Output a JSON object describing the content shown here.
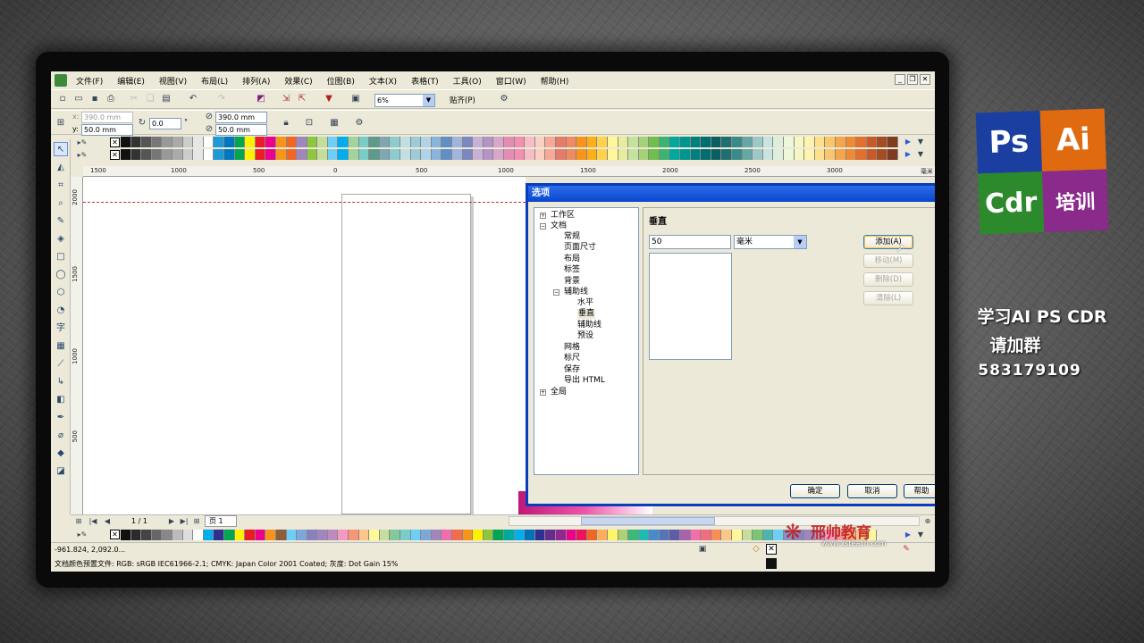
{
  "menu": [
    "文件(F)",
    "编辑(E)",
    "视图(V)",
    "布局(L)",
    "排列(A)",
    "效果(C)",
    "位图(B)",
    "文本(X)",
    "表格(T)",
    "工具(O)",
    "窗口(W)",
    "帮助(H)"
  ],
  "window_controls": [
    "_",
    "❐",
    "✕"
  ],
  "toolbar": {
    "zoom_value": "6%",
    "snap_label": "贴齐(P)"
  },
  "property_bar": {
    "x_value": "390.0 mm",
    "y_value": "50.0 mm",
    "x_prefix": "x:",
    "y_prefix": "y:",
    "angle_value": "0.0",
    "angle_unit": "°",
    "width_value": "390.0 mm",
    "height_value": "50.0 mm"
  },
  "ruler_h_labels": [
    "1500",
    "1000",
    "500",
    "0",
    "500",
    "1000",
    "1500",
    "2000",
    "2500",
    "3000"
  ],
  "ruler_h_unit": "毫米",
  "ruler_v_labels": [
    "2000",
    "1500",
    "1000",
    "500"
  ],
  "palette_top": [
    "#111111",
    "#333333",
    "#555555",
    "#777777",
    "#999999",
    "#aaaaaa",
    "#cccccc",
    "#e6e6e6",
    "#ffffff",
    "#1d9bd6",
    "#0077c0",
    "#00a650",
    "#fff200",
    "#ed1c24",
    "#ec008c",
    "#f7941d",
    "#f26522",
    "#a186be",
    "#8dc63f",
    "#c4df9b",
    "#6dcff6",
    "#00aeef",
    "#a3d39c",
    "#7accc8",
    "#5e9a8b",
    "#7ea7b1",
    "#8ccbd0",
    "#c2e0e3",
    "#9ecbd6",
    "#b1d3e8",
    "#89b4dc",
    "#5f8fc5",
    "#a1b4dc",
    "#7c86c1",
    "#c7b1d6",
    "#b394c5",
    "#d7a6c8",
    "#e58cb3",
    "#f48fb1",
    "#f7bdc7",
    "#fbd0c0",
    "#f7a996",
    "#e57b6a",
    "#ef8a62",
    "#f7941d",
    "#fcaf17",
    "#ffd24c",
    "#fff799",
    "#e6ee9c",
    "#c6e29f",
    "#a5d276",
    "#6ebf4b",
    "#3cb371",
    "#00a99d",
    "#00958f",
    "#007f7f",
    "#006d6f",
    "#0b5f61",
    "#1e6f70",
    "#3a8a8a",
    "#66a8a6",
    "#9cc9c7",
    "#c9e3e1",
    "#ddeedd",
    "#eef7d9",
    "#f7f7c6",
    "#fff3b0",
    "#ffe08a",
    "#f9c66b",
    "#f5a54b",
    "#ee8a36",
    "#e36f2c",
    "#c75a28",
    "#a64c23",
    "#7f3c1f",
    "#5c2c18",
    "#3f1f12",
    "#2a150c"
  ],
  "palette_bottom": [
    "#111111",
    "#2b2b2b",
    "#444444",
    "#666666",
    "#888888",
    "#bbbbbb",
    "#dddddd",
    "#ffffff",
    "#00aeef",
    "#2e3192",
    "#00a651",
    "#fff200",
    "#ed1c24",
    "#ec008c",
    "#f7941d",
    "#8b5e3c",
    "#6dcff6",
    "#7da7d9",
    "#8781bd",
    "#a186be",
    "#bd8cbf",
    "#f49ac2",
    "#f69679",
    "#fdc68a",
    "#fff799",
    "#c4df9b",
    "#82ca9c",
    "#7accc8",
    "#6dcff6",
    "#7ea7d8",
    "#a287bd",
    "#f06eaa",
    "#f26c4f",
    "#f7941d",
    "#fff200",
    "#8dc63f",
    "#00a651",
    "#00a99d",
    "#00aeef",
    "#0072bc",
    "#2e3192",
    "#662d91",
    "#92278f",
    "#ec008c",
    "#ed145b",
    "#f26522",
    "#fbaf5d",
    "#fff568",
    "#acd373",
    "#3cb878",
    "#1cbbb4",
    "#448ccb",
    "#5674b9",
    "#605ca8",
    "#a763a8",
    "#f06eaa",
    "#f26d7d",
    "#f68e56",
    "#fdc689",
    "#fff79a",
    "#c4df9b",
    "#7cc576",
    "#4db6ac",
    "#6dcff6",
    "#8393ca",
    "#8882be",
    "#a186be",
    "#bd8cbf",
    "#f49ac1",
    "#f5989d",
    "#f9ad81",
    "#fdc68a",
    "#fff79a"
  ],
  "dialog": {
    "title": "选项",
    "tree": {
      "workspace": "工作区",
      "document": "文档",
      "general": "常规",
      "page_size": "页面尺寸",
      "layout": "布局",
      "label": "标签",
      "background": "背景",
      "guidelines": "辅助线",
      "horizontal": "水平",
      "vertical": "垂直",
      "guides": "辅助线",
      "presets": "预设",
      "grid": "网格",
      "rulers": "标尺",
      "save": "保存",
      "export_html": "导出 HTML",
      "global": "全局"
    },
    "panel_title": "垂直",
    "value": "50",
    "unit": "毫米",
    "buttons": {
      "add": "添加(A)",
      "move": "移动(M)",
      "delete": "删除(D)",
      "clear": "清除(L)"
    },
    "footer": {
      "ok": "确定",
      "cancel": "取消",
      "help": "帮助"
    }
  },
  "page_nav": {
    "counter": "1 / 1",
    "tab": "页 1"
  },
  "status": {
    "coords": "-961.824, 2,092.0...",
    "profile": "文档颜色预置文件: RGB: sRGB IEC61966-2.1; CMYK: Japan Color 2001 Coated; 灰度: Dot Gain 15%"
  },
  "watermark": {
    "name": "邢帅教育",
    "url": "www.xsteach.com"
  },
  "promo": {
    "ps": "Ps",
    "ai": "Ai",
    "cdr": "Cdr",
    "training": "培训",
    "line1": "学习AI PS CDR",
    "line2": "请加群",
    "line3": "583179109",
    "colors": {
      "ps": "#1a3fa0",
      "ai": "#e06a10",
      "cdr": "#2c8a2c",
      "training": "#8a2a8a"
    }
  }
}
